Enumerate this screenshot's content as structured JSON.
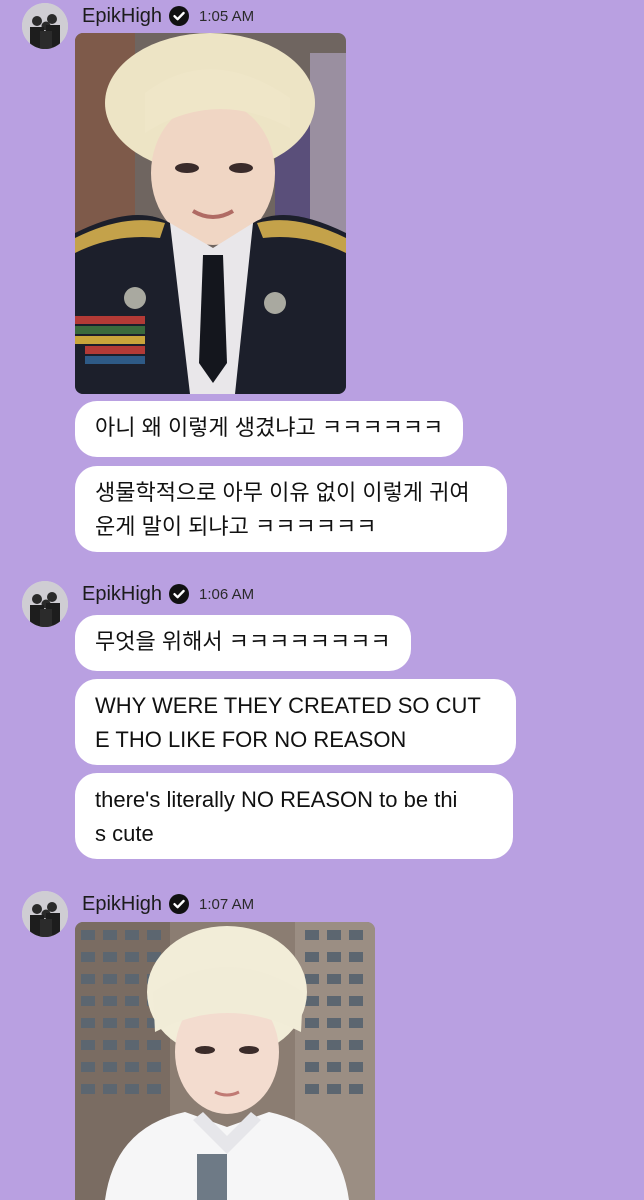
{
  "messages": [
    {
      "sender": "EpikHigh",
      "time": "1:05 AM"
    },
    {
      "sender": "EpikHigh",
      "time": "1:06 AM"
    },
    {
      "sender": "EpikHigh",
      "time": "1:07 AM"
    }
  ],
  "bubbles": [
    "아니 왜 이렇게 생겼냐고 ㅋㅋㅋㅋㅋㅋ",
    "생물학적으로 아무 이유 없이 이렇게 귀여\n운게 말이 되냐고 ㅋㅋㅋㅋㅋㅋ",
    "무엇을 위해서 ㅋㅋㅋㅋㅋㅋㅋㅋ",
    "WHY WERE THEY CREATED SO CUT\nE THO LIKE FOR NO REASON",
    "there's literally NO REASON to be thi\ns cute"
  ],
  "icons": {
    "verified": "verified-badge-icon"
  },
  "colors": {
    "background": "#b9a0e1",
    "bubble": "#ffffff"
  }
}
